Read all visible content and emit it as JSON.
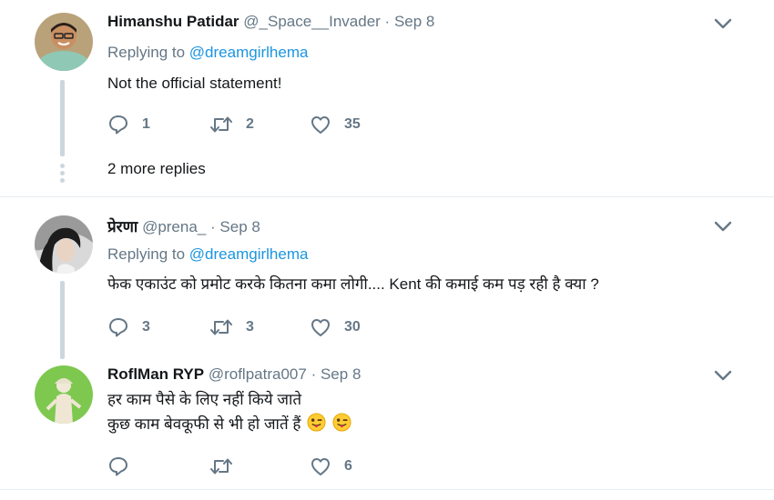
{
  "tweets": [
    {
      "name": "Himanshu Patidar",
      "handle": "@_Space__Invader",
      "sep": "·",
      "date": "Sep 8",
      "replying_prefix": "Replying to",
      "replying_mention": "@dreamgirlhema",
      "text": "Not the official statement!",
      "reply_count": "1",
      "retweet_count": "2",
      "like_count": "35",
      "more_replies": "2 more replies"
    },
    {
      "name": "प्रेरणा",
      "handle": "@prena_",
      "sep": "·",
      "date": "Sep 8",
      "replying_prefix": "Replying to",
      "replying_mention": "@dreamgirlhema",
      "text": "फेक एकाउंट को प्रमोट करके कितना कमा लोगी.... Kent की कमाई कम पड़ रही है क्या ?",
      "reply_count": "3",
      "retweet_count": "3",
      "like_count": "30"
    },
    {
      "name": "RoflMan RYP",
      "handle": "@roflpatra007",
      "sep": "·",
      "date": "Sep 8",
      "text_line1": "हर काम पैसे के लिए नहीं किये जाते",
      "text_line2": "कुछ काम बेवकूफी से भी हो जातें हैं",
      "reply_count": "",
      "retweet_count": "",
      "like_count": "6"
    }
  ],
  "icons": {
    "reply": "reply-icon",
    "retweet": "retweet-icon",
    "like": "heart-icon",
    "menu": "chevron-down-icon",
    "emoji": "winking-face-with-tongue-emoji"
  },
  "colors": {
    "text": "#14171a",
    "secondary": "#657786",
    "link": "#1b95e0",
    "thread_line": "#ccd6dd",
    "divider": "#e6ecf0"
  }
}
